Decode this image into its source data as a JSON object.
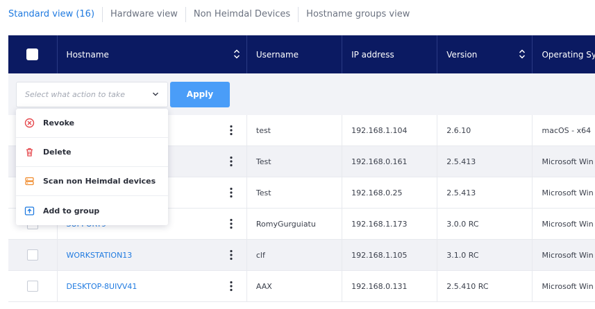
{
  "tabs": [
    {
      "label": "Standard view (16)",
      "active": true
    },
    {
      "label": "Hardware view",
      "active": false
    },
    {
      "label": "Non Heimdal Devices",
      "active": false
    },
    {
      "label": "Hostname groups view",
      "active": false
    }
  ],
  "table": {
    "headers": [
      "Hostname",
      "Username",
      "IP address",
      "Version",
      "Operating Sys"
    ],
    "rows": [
      {
        "hostname": "",
        "username": "test",
        "ip": "192.168.1.104",
        "version": "2.6.10",
        "os": "macOS - x64"
      },
      {
        "hostname": "",
        "username": "Test",
        "ip": "192.168.0.161",
        "version": "2.5.413",
        "os": "Microsoft Win"
      },
      {
        "hostname": "",
        "username": "Test",
        "ip": "192.168.0.25",
        "version": "2.5.413",
        "os": "Microsoft Win"
      },
      {
        "hostname": "SUPPORT9",
        "username": "RomyGurguiatu",
        "ip": "192.168.1.173",
        "version": "3.0.0 RC",
        "os": "Microsoft Win"
      },
      {
        "hostname": "WORKSTATION13",
        "username": "clf",
        "ip": "192.168.1.105",
        "version": "3.1.0 RC",
        "os": "Microsoft Win"
      },
      {
        "hostname": "DESKTOP-8UIVV41",
        "username": "AAX",
        "ip": "192.168.0.131",
        "version": "2.5.410 RC",
        "os": "Microsoft Win"
      }
    ]
  },
  "actions": {
    "placeholder": "Select what action to take",
    "apply_label": "Apply",
    "menu": [
      {
        "label": "Revoke",
        "icon": "revoke-icon"
      },
      {
        "label": "Delete",
        "icon": "trash-icon"
      },
      {
        "label": "Scan non Heimdal devices",
        "icon": "scan-icon"
      },
      {
        "label": "Add to group",
        "icon": "add-to-group-icon"
      }
    ]
  },
  "colors": {
    "header_bg": "#0b1a62",
    "accent_blue": "#1f7ae0",
    "apply_button": "#4a9df8",
    "revoke_red": "#e5484d",
    "scan_orange": "#f08c2e"
  }
}
